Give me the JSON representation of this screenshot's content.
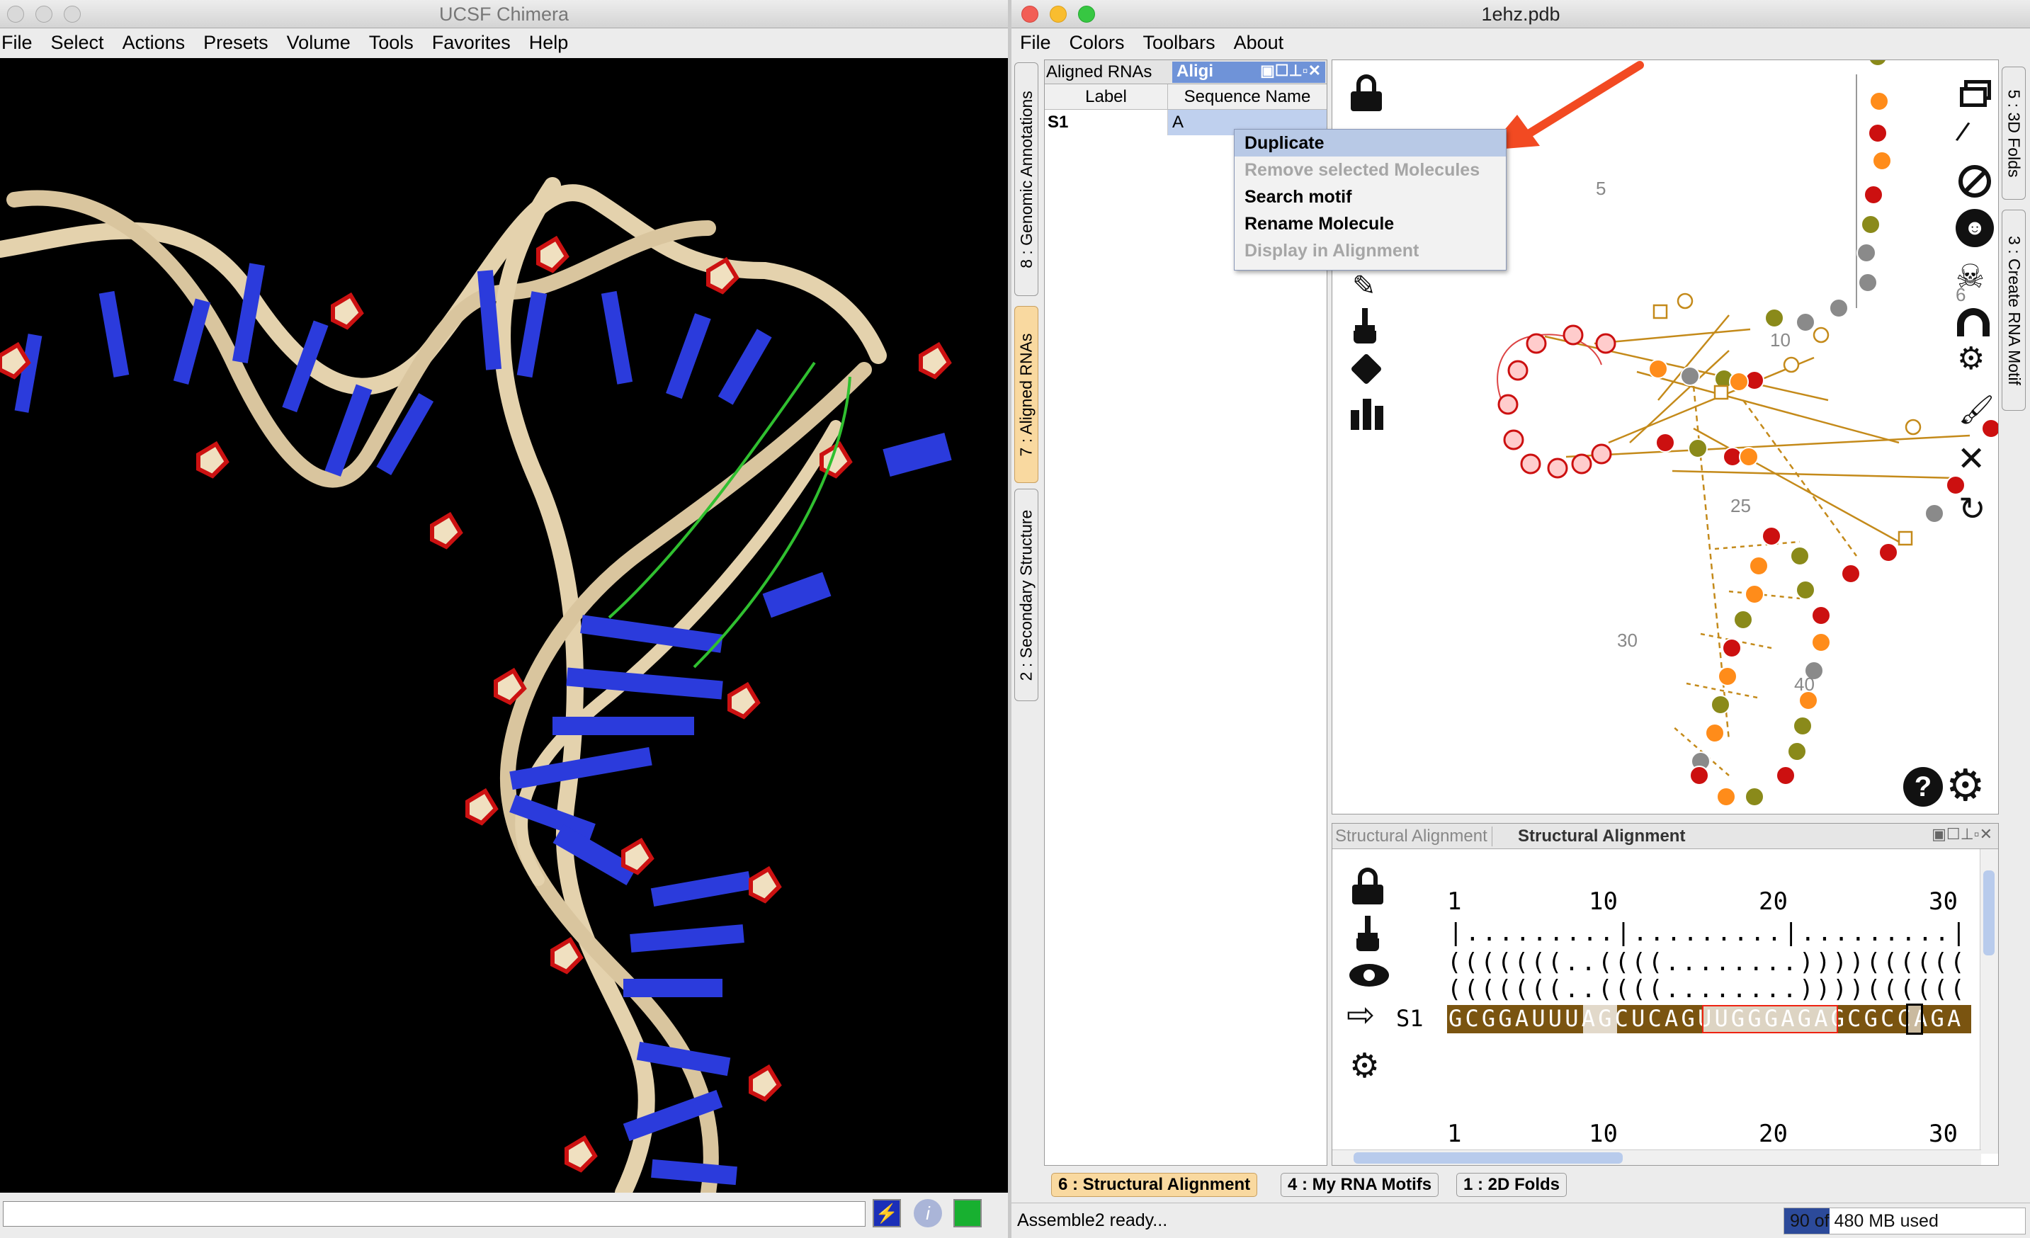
{
  "chimera": {
    "title": "UCSF Chimera",
    "menu": [
      "File",
      "Select",
      "Actions",
      "Presets",
      "Volume",
      "Tools",
      "Favorites",
      "Help"
    ]
  },
  "assemble": {
    "title": "1ehz.pdb",
    "menu": [
      "File",
      "Colors",
      "Toolbars",
      "About"
    ],
    "left_tabs": [
      "8 : Genomic Annotations",
      "7 : Aligned RNAs",
      "2 : Secondary Structure"
    ],
    "right_tabs": [
      "5 : 3D Folds",
      "3 : Create RNA Motif"
    ],
    "panel_tabs": [
      "Aligned RNAs",
      "Aligi"
    ],
    "table": {
      "headers": [
        "Label",
        "Sequence Name"
      ],
      "rows": [
        {
          "label": "S1",
          "name": "A"
        }
      ]
    },
    "context_menu": [
      {
        "label": "Duplicate",
        "enabled": true
      },
      {
        "label": "Remove selected Molecules",
        "enabled": false
      },
      {
        "label": "Search motif",
        "enabled": true
      },
      {
        "label": "Rename Molecule",
        "enabled": true
      },
      {
        "label": "Display in Alignment",
        "enabled": false
      }
    ],
    "structure_labels": [
      "5",
      "10",
      "25",
      "30",
      "40",
      "6"
    ],
    "alignment": {
      "tabs": [
        "Structural Alignment",
        "Structural Alignment"
      ],
      "ruler": [
        "1",
        "10",
        "20",
        "30"
      ],
      "tick_line": "|.........|.........|.........|",
      "bracket_line_1": "(((((((..((((........))))((((((",
      "bracket_line_2": "(((((((..((((........))))((((((",
      "seq_label": "S1",
      "sequence": "GCGGAUUUAGCUCAGUUGGGAGAGCGCCAGA"
    },
    "bottom_tabs": [
      "6 : Structural Alignment",
      "4 : My RNA Motifs",
      "1 : 2D Folds"
    ],
    "status": "Assemble2 ready...",
    "memory": "90 of 480 MB used",
    "memory_fraction": 0.1875
  }
}
